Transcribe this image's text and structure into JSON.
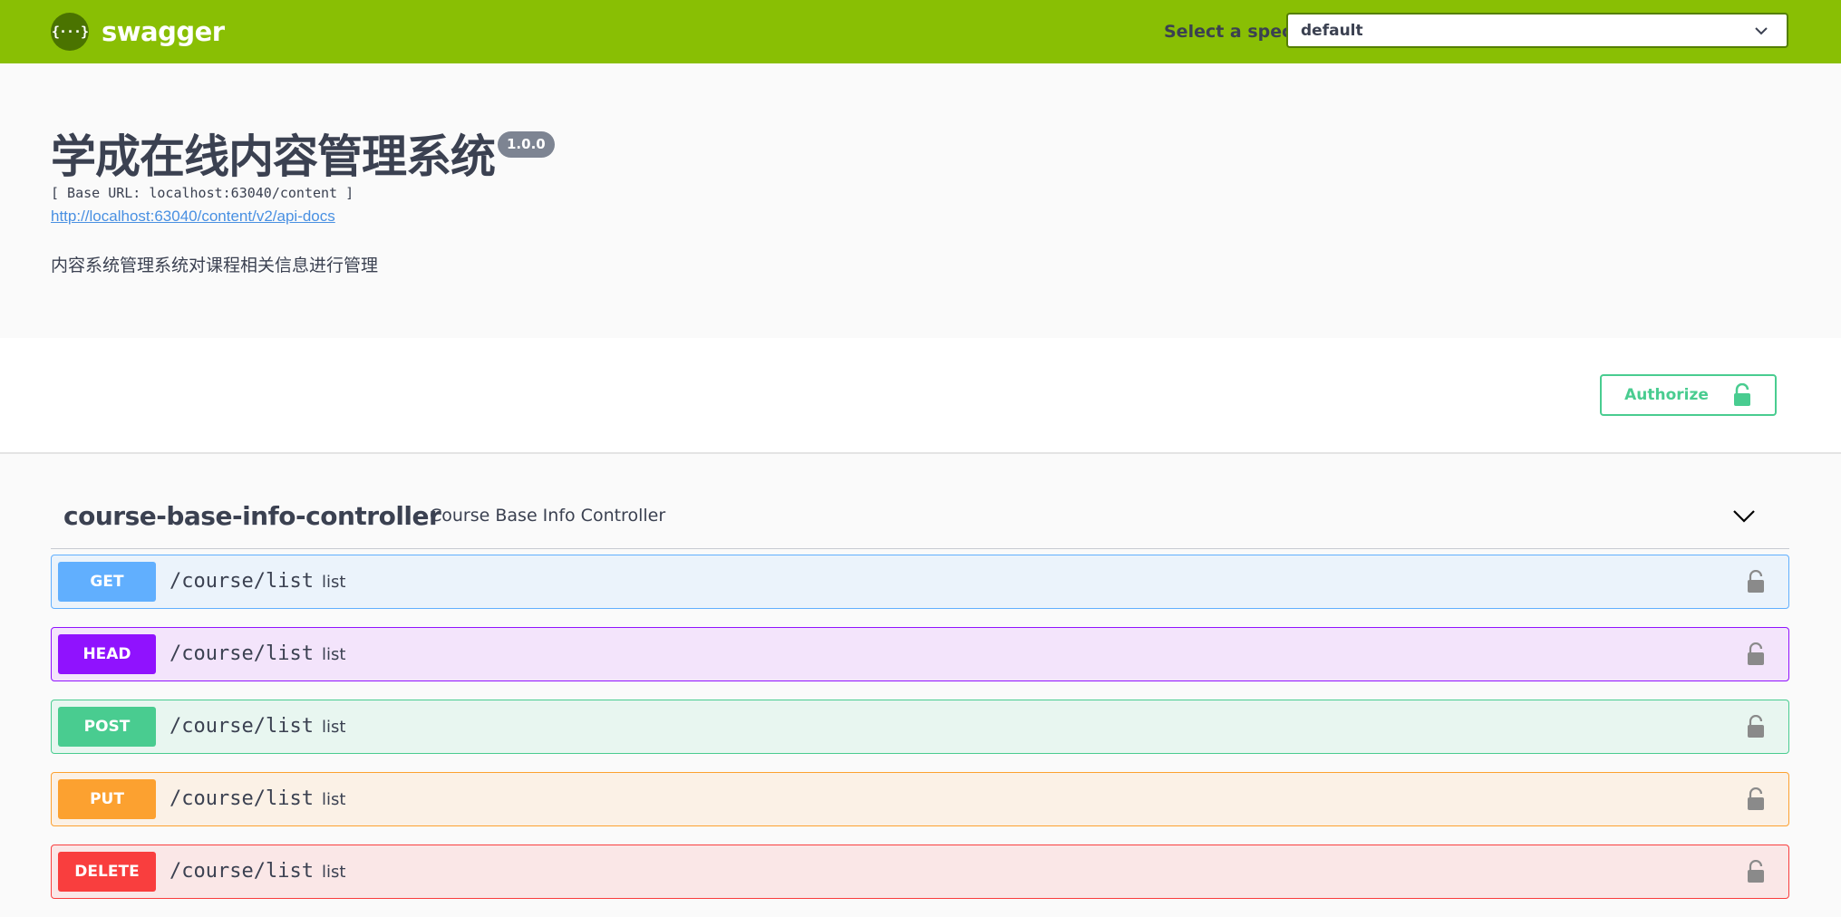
{
  "topbar": {
    "logo_glyph": "{···}",
    "brand": "swagger",
    "spec_label": "Select a spec",
    "spec_selected": "default",
    "colors": {
      "background": "#89bf04",
      "select_border": "#547f00"
    }
  },
  "info": {
    "title": "学成在线内容管理系统",
    "version": "1.0.0",
    "base_url": "[ Base URL: localhost:63040/content ]",
    "api_docs_link": "http://localhost:63040/content/v2/api-docs",
    "description": "内容系统管理系统对课程相关信息进行管理"
  },
  "scheme": {
    "authorize_label": "Authorize",
    "authorize_icon": "lock-open-icon",
    "accent": "#49cc90"
  },
  "tag": {
    "name": "course-base-info-controller",
    "description": "Course Base Info Controller",
    "expanded": true,
    "chevron_icon": "chevron-down-icon"
  },
  "operations": [
    {
      "method": "GET",
      "path": "/course/list",
      "summary": "list",
      "color": "#61affe",
      "lock_icon": "lock-icon"
    },
    {
      "method": "HEAD",
      "path": "/course/list",
      "summary": "list",
      "color": "#9012fe",
      "lock_icon": "lock-icon"
    },
    {
      "method": "POST",
      "path": "/course/list",
      "summary": "list",
      "color": "#49cc90",
      "lock_icon": "lock-icon"
    },
    {
      "method": "PUT",
      "path": "/course/list",
      "summary": "list",
      "color": "#fca130",
      "lock_icon": "lock-icon"
    },
    {
      "method": "DELETE",
      "path": "/course/list",
      "summary": "list",
      "color": "#f93e3e",
      "lock_icon": "lock-icon"
    }
  ]
}
